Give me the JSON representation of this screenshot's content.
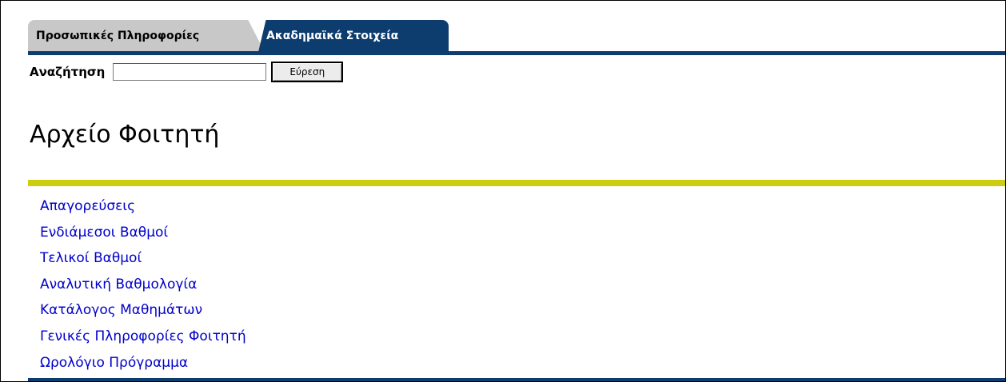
{
  "tabs": [
    {
      "label": "Προσωπικές Πληροφορίες",
      "active": false
    },
    {
      "label": "Ακαδημαϊκά Στοιχεία",
      "active": true
    }
  ],
  "search": {
    "label": "Αναζήτηση",
    "value": "",
    "placeholder": "",
    "button_label": "Εύρεση"
  },
  "page": {
    "title": "Αρχείο Φοιτητή"
  },
  "links": [
    "Απαγορεύσεις",
    "Ενδιάμεσοι Βαθμοί",
    "Τελικοί Βαθμοί",
    "Αναλυτική Βαθμολογία",
    "Κατάλογος Μαθημάτων",
    "Γενικές Πληροφορίες Φοιτητή",
    "Ωρολόγιο Πρόγραμμα"
  ],
  "colors": {
    "tab_active": "#0d3d6e",
    "tab_inactive": "#c8c8c8",
    "title_rule": "#cccc11",
    "link": "#0000cc"
  }
}
